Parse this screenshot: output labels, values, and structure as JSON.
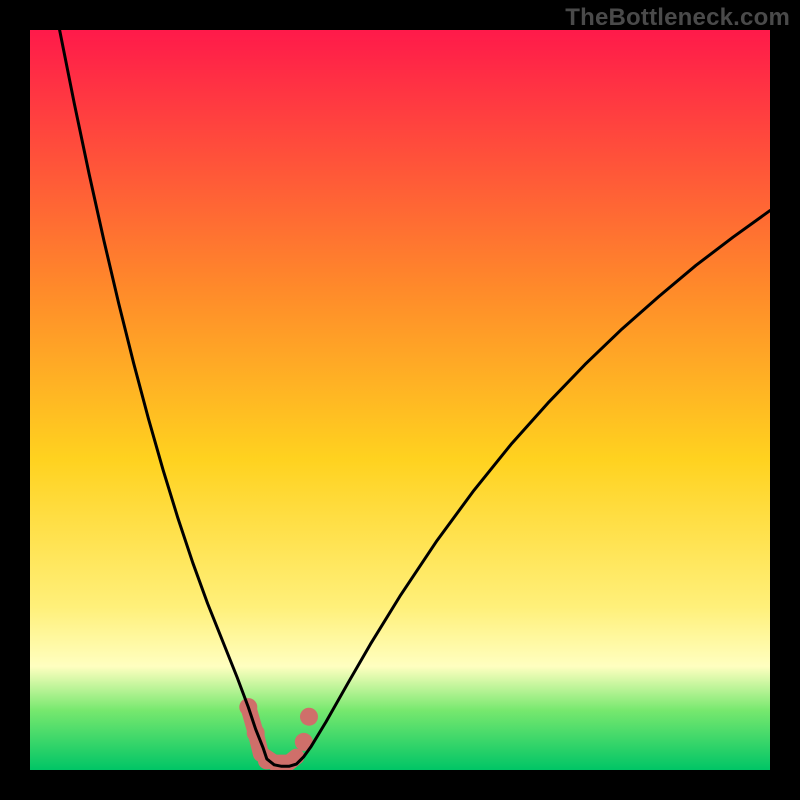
{
  "watermark": "TheBottleneck.com",
  "colors": {
    "bg": "#000000",
    "grad_top": "#ff1a4a",
    "grad_mid1": "#ff8a2a",
    "grad_mid2": "#ffd21f",
    "grad_mid3": "#fff07a",
    "grad_band": "#ffffc0",
    "grad_bottom1": "#76e86e",
    "grad_bottom2": "#00c566",
    "curve": "#000000",
    "marker": "#cf6f6a"
  },
  "chart_data": {
    "type": "line",
    "title": "",
    "xlabel": "",
    "ylabel": "",
    "xlim": [
      0,
      100
    ],
    "ylim": [
      0,
      100
    ],
    "grid": false,
    "legend": false,
    "series": [
      {
        "name": "bottleneck-curve",
        "x": [
          4,
          6,
          8,
          10,
          12,
          14,
          16,
          18,
          20,
          22,
          24,
          26,
          28,
          29.5,
          30.5,
          31.5,
          32,
          33,
          34,
          35,
          36,
          37,
          38,
          40,
          43,
          46,
          50,
          55,
          60,
          65,
          70,
          75,
          80,
          85,
          90,
          95,
          100
        ],
        "y": [
          100,
          90,
          80.5,
          71.5,
          63,
          55,
          47.5,
          40.5,
          34,
          28,
          22.5,
          17.5,
          12.5,
          8.5,
          5.5,
          3,
          1.5,
          0.7,
          0.5,
          0.5,
          0.8,
          1.8,
          3.2,
          6.5,
          11.8,
          17,
          23.5,
          31,
          37.8,
          44,
          49.6,
          54.8,
          59.6,
          64,
          68.2,
          72,
          75.6
        ]
      }
    ],
    "markers": [
      {
        "name": "left-dot-top",
        "x": 29.5,
        "y": 8.5
      },
      {
        "name": "left-dot-low",
        "x": 30.5,
        "y": 5.0
      },
      {
        "name": "elbow-center",
        "x": 32.0,
        "y": 1.3
      },
      {
        "name": "right-dot-mid",
        "x": 37.0,
        "y": 3.8
      },
      {
        "name": "right-dot-top",
        "x": 37.7,
        "y": 7.2
      }
    ],
    "marker_stroke_segments": [
      {
        "from": [
          29.5,
          8.5
        ],
        "to": [
          30.5,
          5.0
        ]
      },
      {
        "from": [
          30.5,
          5.0
        ],
        "to": [
          31.2,
          2.2
        ]
      },
      {
        "from": [
          31.2,
          2.2
        ],
        "to": [
          33.0,
          1.0
        ]
      },
      {
        "from": [
          33.0,
          1.0
        ],
        "to": [
          35.0,
          1.0
        ]
      },
      {
        "from": [
          35.0,
          1.0
        ],
        "to": [
          36.0,
          1.8
        ]
      }
    ]
  }
}
